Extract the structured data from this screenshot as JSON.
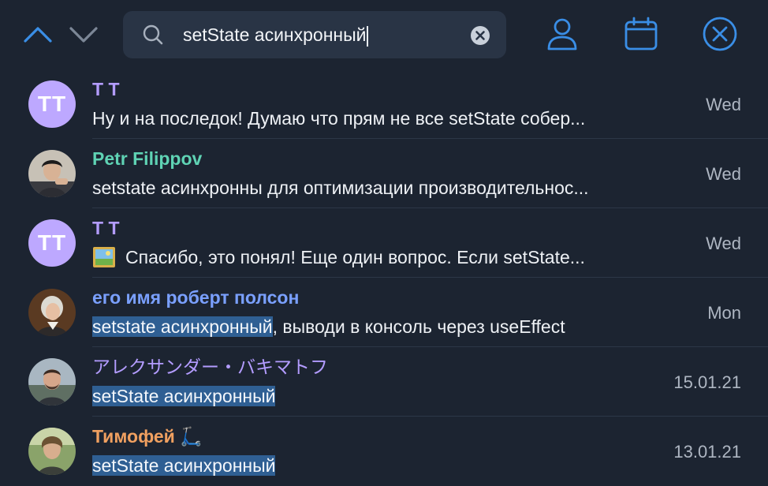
{
  "search": {
    "query": "setState асинхронный"
  },
  "colors": {
    "accent": "#3a8ee6",
    "highlight": "#2f5f93",
    "background": "#1c2431"
  },
  "results": [
    {
      "name": "T T",
      "avatar_initials": "TT",
      "name_color": "#b39cff",
      "message": "Ну и на последок! Думаю что прям не все setState собер...",
      "highlight": "",
      "message_rest": "",
      "date": "Wed"
    },
    {
      "name": "Petr Filippov",
      "avatar_initials": "",
      "name_color": "#5fd3b4",
      "message": "setstate асинхронны для оптимизации производительнос...",
      "highlight": "",
      "message_rest": "",
      "date": "Wed"
    },
    {
      "name": "T T",
      "avatar_initials": "TT",
      "name_color": "#b39cff",
      "message": "Спасибо, это понял! Еще один вопрос. Если setState...",
      "highlight": "",
      "message_rest": "",
      "date": "Wed"
    },
    {
      "name": "его имя роберт полсон",
      "avatar_initials": "",
      "name_color": "#7aa0ff",
      "message": "",
      "highlight": "setstate асинхронный",
      "message_rest": ", выводи в консоль через useEffect",
      "date": "Mon"
    },
    {
      "name": "アレクサンダー・バキマトフ",
      "avatar_initials": "",
      "name_color": "#b39cff",
      "message": "",
      "highlight": "setState асинхронный",
      "message_rest": "",
      "date": "15.01.21"
    },
    {
      "name": "Тимофей 🛴",
      "avatar_initials": "",
      "name_color": "#f0a060",
      "message": "",
      "highlight": "setState асинхронный",
      "message_rest": "",
      "date": "13.01.21"
    }
  ],
  "icons": {
    "up": "chevron-up-icon",
    "down": "chevron-down-icon",
    "search": "search-icon",
    "clear": "clear-icon",
    "user": "user-icon",
    "calendar": "calendar-icon",
    "close": "close-icon"
  }
}
